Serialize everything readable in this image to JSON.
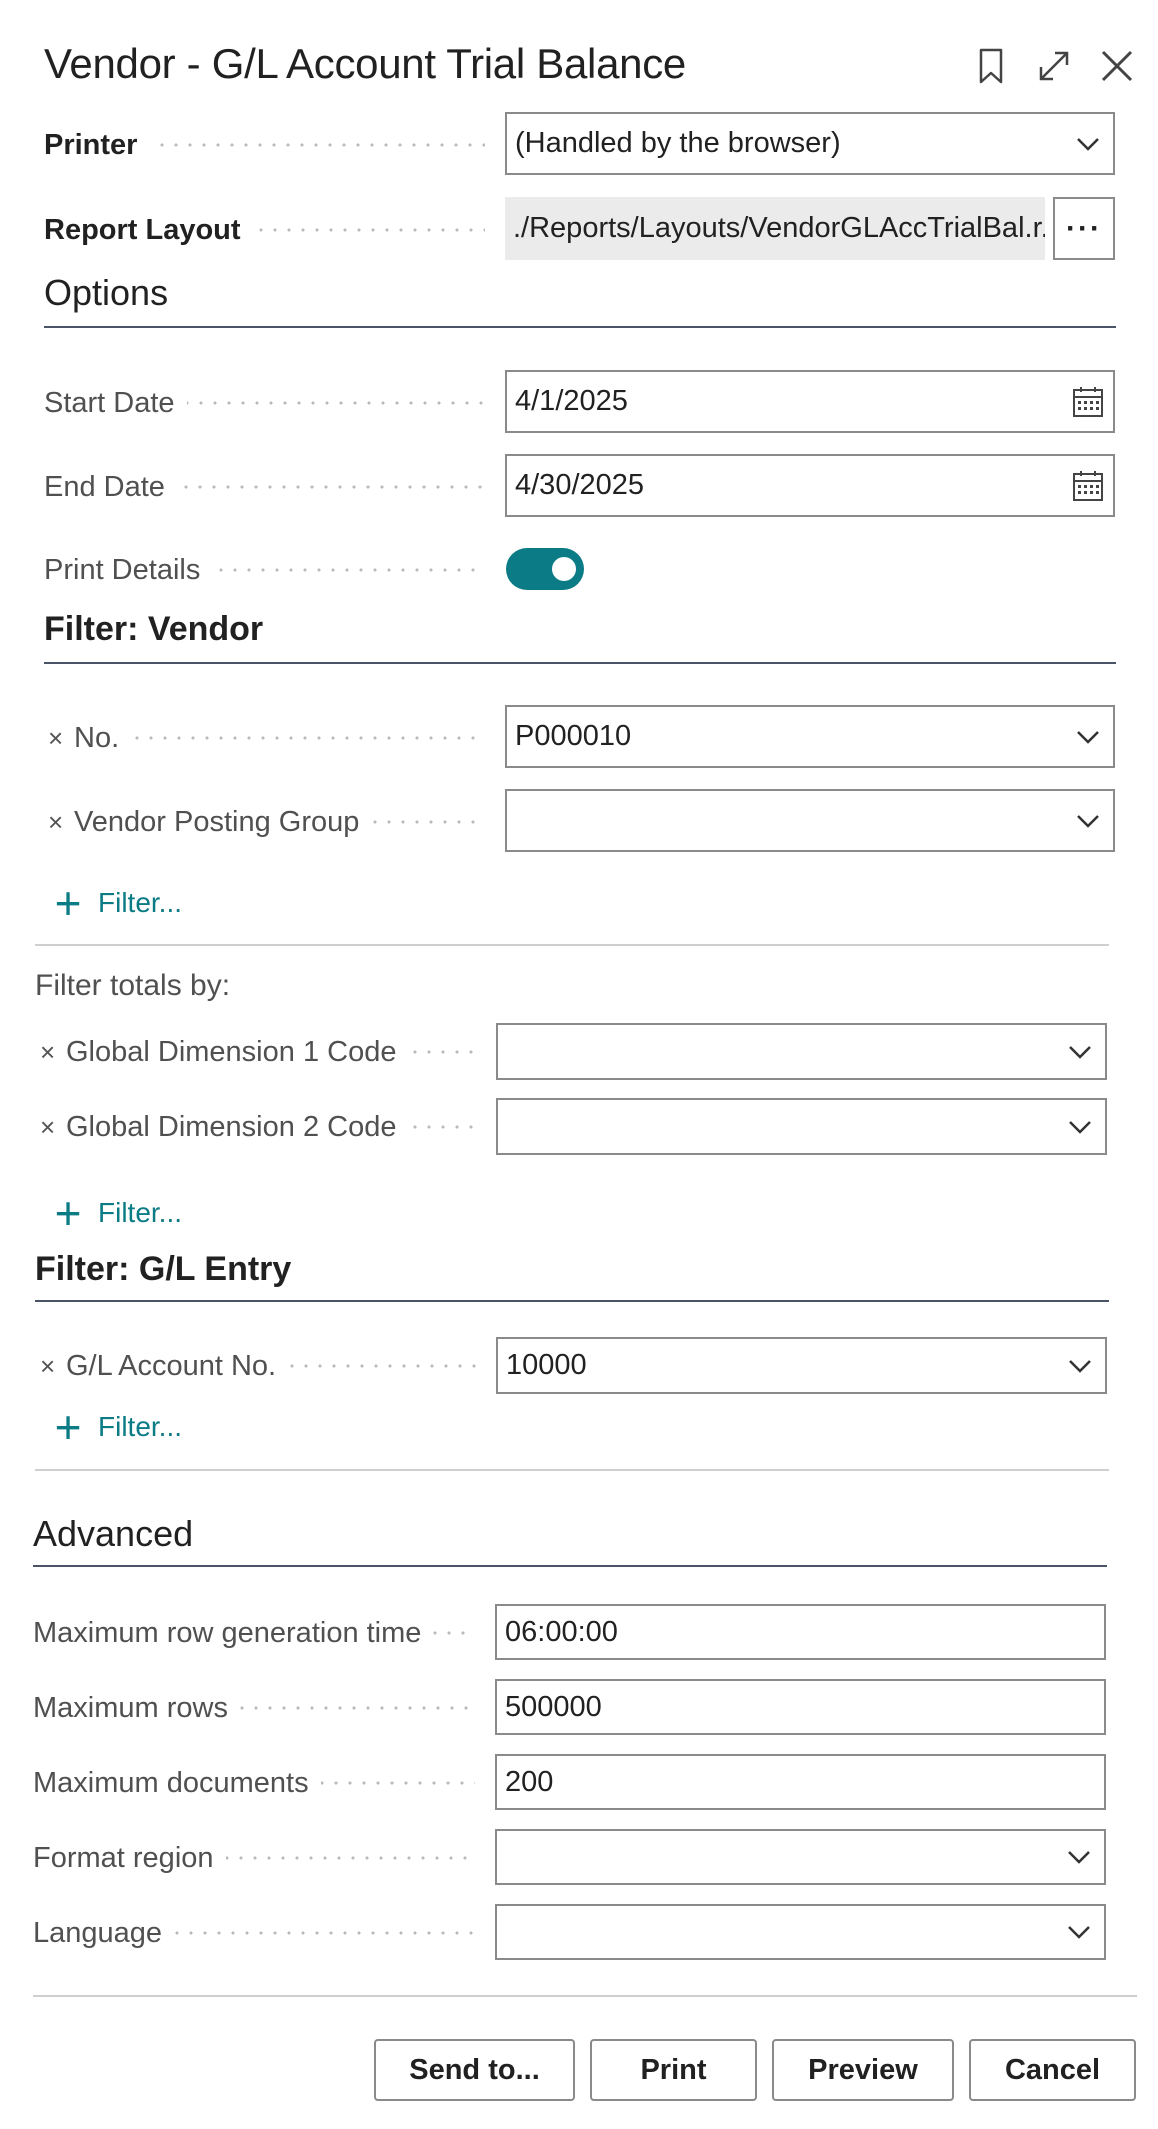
{
  "dialog": {
    "title": "Vendor - G/L Account Trial Balance"
  },
  "header_icons": [
    "bookmark-icon",
    "expand-icon",
    "close-icon"
  ],
  "printer": {
    "label": "Printer",
    "value": "(Handled by the browser)"
  },
  "report_layout": {
    "label": "Report Layout",
    "value": "./Reports/Layouts/VendorGLAccTrialBal.r...",
    "button": "···"
  },
  "options": {
    "heading": "Options",
    "start_date": {
      "label": "Start Date",
      "value": "4/1/2025"
    },
    "end_date": {
      "label": "End Date",
      "value": "4/30/2025"
    },
    "print_details": {
      "label": "Print Details",
      "on": true
    }
  },
  "filter_vendor": {
    "heading": "Filter: Vendor",
    "no": {
      "label": "No.",
      "value": "P000010"
    },
    "posting_group": {
      "label": "Vendor Posting Group",
      "value": ""
    },
    "add_filter": "Filter..."
  },
  "filter_totals": {
    "heading": "Filter totals by:",
    "dim1": {
      "label": "Global Dimension 1 Code",
      "value": ""
    },
    "dim2": {
      "label": "Global Dimension 2 Code",
      "value": ""
    },
    "add_filter": "Filter..."
  },
  "filter_gl": {
    "heading": "Filter: G/L Entry",
    "account_no": {
      "label": "G/L Account No.",
      "value": "10000"
    },
    "add_filter": "Filter..."
  },
  "advanced": {
    "heading": "Advanced",
    "max_time": {
      "label": "Maximum row generation time",
      "value": "06:00:00"
    },
    "max_rows": {
      "label": "Maximum rows",
      "value": "500000"
    },
    "max_docs": {
      "label": "Maximum documents",
      "value": "200"
    },
    "format_region": {
      "label": "Format region",
      "value": ""
    },
    "language": {
      "label": "Language",
      "value": ""
    }
  },
  "buttons": {
    "send_to": "Send to...",
    "print": "Print",
    "preview": "Preview",
    "cancel": "Cancel"
  },
  "colors": {
    "accent": "#0b7b85",
    "border": "#8a8a8a",
    "readonly_bg": "#ebebeb"
  }
}
